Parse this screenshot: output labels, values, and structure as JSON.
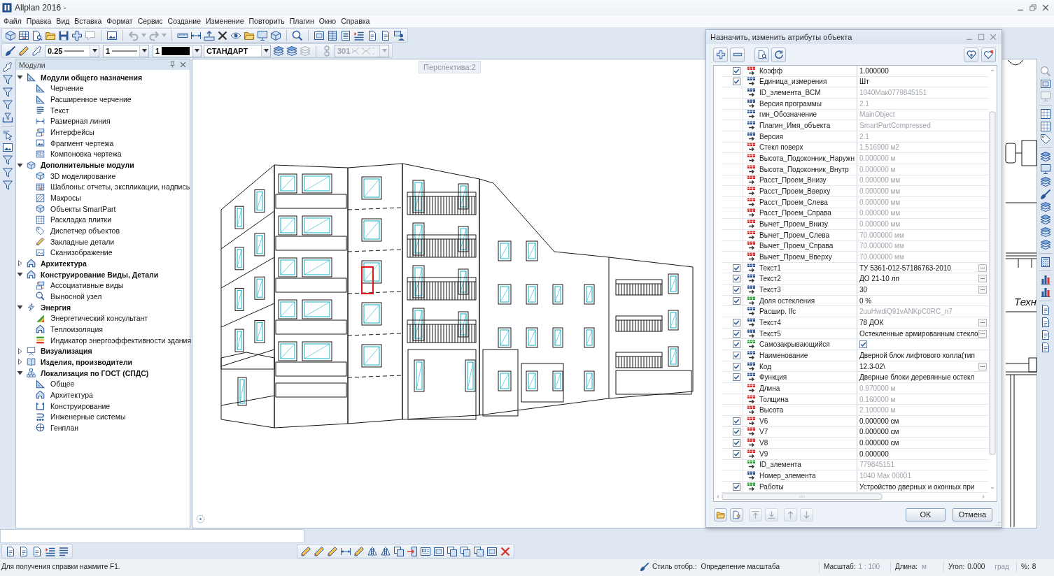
{
  "window": {
    "title": "Allplan 2016 -"
  },
  "menu": [
    "Файл",
    "Правка",
    "Вид",
    "Вставка",
    "Формат",
    "Сервис",
    "Создание",
    "Изменение",
    "Повторить",
    "Плагин",
    "Окно",
    "Справка"
  ],
  "standard_toolbar": [
    {
      "disabled": false
    },
    {
      "disabled": false
    },
    {
      "disabled": false
    },
    {
      "disabled": false
    },
    {
      "disabled": false
    },
    {
      "disabled": false
    },
    {
      "disabled": true
    },
    {
      "disabled": false
    },
    {
      "disabled": true
    },
    {
      "disabled": true
    },
    {
      "disabled": false
    },
    {
      "disabled": false
    },
    {
      "disabled": false
    },
    {
      "disabled": false
    },
    {
      "disabled": false
    },
    {
      "disabled": false
    },
    {
      "disabled": false
    },
    {
      "disabled": false
    },
    {
      "disabled": false
    },
    {
      "disabled": false
    },
    {
      "disabled": false
    },
    {
      "disabled": false
    },
    {
      "disabled": false
    },
    {
      "disabled": false
    },
    {
      "disabled": false
    },
    {
      "disabled": false
    }
  ],
  "format_toolbar": {
    "pen_thickness": "0.25",
    "line_type": "1",
    "color_number": "1",
    "line_style": "СТАНДАРТ",
    "layer_tools": [
      {
        "disabled": false
      },
      {
        "disabled": false
      },
      {
        "disabled": true
      },
      {
        "disabled": true
      }
    ],
    "pattern": {
      "value": "301",
      "disabled": true
    }
  },
  "modules_panel": {
    "title": "Модули",
    "tree": [
      {
        "label": "Модули общего назначения",
        "expanded": true,
        "children": [
          {
            "label": "Черчение"
          },
          {
            "label": "Расширенное черчение"
          },
          {
            "label": "Текст"
          },
          {
            "label": "Размерная линия"
          },
          {
            "label": "Интерфейсы"
          },
          {
            "label": "Фрагмент чертежа"
          },
          {
            "label": "Компоновка чертежа"
          }
        ]
      },
      {
        "label": "Дополнительные модули",
        "expanded": true,
        "children": [
          {
            "label": "3D моделирование"
          },
          {
            "label": "Шаблоны: отчеты, экспликации, надпись"
          },
          {
            "label": "Макросы"
          },
          {
            "label": "Объекты SmartPart"
          },
          {
            "label": "Раскладка плитки"
          },
          {
            "label": "Диспетчер объектов"
          },
          {
            "label": "Закладные детали"
          },
          {
            "label": "Сканизображение"
          }
        ]
      },
      {
        "label": "Архитектура",
        "expanded": false
      },
      {
        "label": "Конструирование Виды, Детали",
        "expanded": true,
        "children": [
          {
            "label": "Ассоциативные виды"
          },
          {
            "label": "Выносной узел"
          }
        ]
      },
      {
        "label": "Энергия",
        "expanded": true,
        "children": [
          {
            "label": "Энергетический консультант"
          },
          {
            "label": "Теплоизоляция"
          },
          {
            "label": "Индикатор энергоэффективности здания"
          }
        ]
      },
      {
        "label": "Визуализация",
        "expanded": false
      },
      {
        "label": "Изделия, производители",
        "expanded": false
      },
      {
        "label": "Локализация по ГОСТ (СПДС)",
        "expanded": true,
        "children": [
          {
            "label": "Общее"
          },
          {
            "label": "Архитектура"
          },
          {
            "label": "Конструирование"
          },
          {
            "label": "Инженерные системы"
          },
          {
            "label": "Генплан"
          }
        ]
      }
    ]
  },
  "viewport": {
    "view_label": "Перспектива:2",
    "drawing_text": "Техн"
  },
  "right_toolbar": [
    {
      "disabled": true
    },
    {
      "disabled": false
    },
    {
      "disabled": true
    },
    {
      "disabled": false
    },
    {
      "disabled": false
    },
    {
      "disabled": false
    },
    {
      "disabled": false
    },
    {
      "disabled": false
    },
    {
      "disabled": false
    },
    {
      "disabled": false
    },
    {
      "disabled": false
    },
    {
      "disabled": false
    },
    {
      "disabled": false
    },
    {
      "disabled": false
    },
    {
      "disabled": false
    },
    {
      "disabled": false
    },
    {
      "disabled": false
    },
    {
      "disabled": false
    },
    {
      "disabled": false
    },
    {
      "disabled": false
    },
    {
      "disabled": false
    }
  ],
  "dialog": {
    "title": "Назначить, изменить атрибуты объекта",
    "rows": [
      {
        "checked": true,
        "kind": "float",
        "name": "Коэфф",
        "value": "1.000000",
        "read_only": false
      },
      {
        "checked": true,
        "kind": "text",
        "name": "Единица_измерения",
        "value": "Шт",
        "read_only": false
      },
      {
        "checked": false,
        "kind": "text",
        "name": "ID_элемента_BCM",
        "value": "1040Мак0779845151",
        "read_only": true
      },
      {
        "checked": false,
        "kind": "text",
        "name": "Версия программы",
        "value": "2.1",
        "read_only": true
      },
      {
        "checked": false,
        "kind": "text",
        "name": "гин_Обозначение",
        "value": "MainObject",
        "read_only": true
      },
      {
        "checked": false,
        "kind": "text",
        "name": "Плагин_Имя_объекта",
        "value": "SmartPartCompressed",
        "read_only": true
      },
      {
        "checked": false,
        "kind": "text",
        "name": "Версия",
        "value": "2.1",
        "read_only": true
      },
      {
        "checked": false,
        "kind": "float",
        "name": "Стекл поверх",
        "value": "1.516900 м2",
        "read_only": true
      },
      {
        "checked": false,
        "kind": "float",
        "name": "Высота_Подоконник_Наружн",
        "value": "0.000000 м",
        "read_only": true
      },
      {
        "checked": false,
        "kind": "float",
        "name": "Высота_Подоконник_Внутр",
        "value": "0.000000 м",
        "read_only": true
      },
      {
        "checked": false,
        "kind": "float",
        "name": "Расст_Проем_Внизу",
        "value": "0.000000 мм",
        "read_only": true
      },
      {
        "checked": false,
        "kind": "float",
        "name": "Расст_Проем_Вверху",
        "value": "0.000000 мм",
        "read_only": true
      },
      {
        "checked": false,
        "kind": "float",
        "name": "Расст_Проем_Слева",
        "value": "0.000000 мм",
        "read_only": true
      },
      {
        "checked": false,
        "kind": "float",
        "name": "Расст_Проем_Справа",
        "value": "0.000000 мм",
        "read_only": true
      },
      {
        "checked": false,
        "kind": "float",
        "name": "Вычет_Проем_Внизу",
        "value": "0.000000 мм",
        "read_only": true
      },
      {
        "checked": false,
        "kind": "float",
        "name": "Вычет_Проем_Слева",
        "value": "70.000000 мм",
        "read_only": true
      },
      {
        "checked": false,
        "kind": "float",
        "name": "Вычет_Проем_Справа",
        "value": "70.000000 мм",
        "read_only": true
      },
      {
        "checked": false,
        "kind": "float",
        "name": "Вычет_Проем_Вверху",
        "value": "70.000000 мм",
        "read_only": true
      },
      {
        "checked": true,
        "kind": "text",
        "name": "Текст1",
        "value": "ТУ 5361-012-57186763-2010",
        "read_only": false,
        "button": "..."
      },
      {
        "checked": true,
        "kind": "text",
        "name": "Текст2",
        "value": "ДО 21-10 лп",
        "read_only": false,
        "button": "..."
      },
      {
        "checked": true,
        "kind": "text",
        "name": "Текст3",
        "value": "30",
        "read_only": false,
        "button": "..."
      },
      {
        "checked": true,
        "kind": "integer",
        "name": "Доля остекления",
        "value": "0 %",
        "read_only": false
      },
      {
        "checked": false,
        "kind": "text",
        "name": "Расшир. Ifc",
        "value": "2uuHwdiQ91vANKpC0RC_n7",
        "read_only": true
      },
      {
        "checked": true,
        "kind": "text",
        "name": "Текст4",
        "value": "78 ДОК",
        "read_only": false,
        "button": "..."
      },
      {
        "checked": true,
        "kind": "text",
        "name": "Текст5",
        "value": "Остекленные армированным стекло",
        "read_only": false,
        "button": "..."
      },
      {
        "checked": true,
        "kind": "integer",
        "name": "Самозакрывающийся",
        "value_checked": true,
        "read_only": false
      },
      {
        "checked": true,
        "kind": "text",
        "name": "Наименование",
        "value": "Дверной блок лифтового холла(тип",
        "read_only": false
      },
      {
        "checked": true,
        "kind": "text",
        "name": "Код",
        "value": "12.3-02\\",
        "read_only": false,
        "button": "..."
      },
      {
        "checked": true,
        "kind": "text",
        "name": "Функция",
        "value": "Дверные блоки деревянные остекл",
        "read_only": false
      },
      {
        "checked": false,
        "kind": "float",
        "name": "Длина",
        "value": "0.970000 м",
        "read_only": true
      },
      {
        "checked": false,
        "kind": "float",
        "name": "Толщина",
        "value": "0.160000 м",
        "read_only": true
      },
      {
        "checked": false,
        "kind": "float",
        "name": "Высота",
        "value": "2.100000 м",
        "read_only": true
      },
      {
        "checked": true,
        "kind": "float",
        "name": "V6",
        "value": "0.000000 см",
        "read_only": false
      },
      {
        "checked": true,
        "kind": "float",
        "name": "V7",
        "value": "0.000000 см",
        "read_only": false
      },
      {
        "checked": true,
        "kind": "float",
        "name": "V8",
        "value": "0.000000 см",
        "read_only": false
      },
      {
        "checked": true,
        "kind": "float",
        "name": "V9",
        "value": "0.000000",
        "read_only": false
      },
      {
        "checked": false,
        "kind": "integer",
        "name": "ID_элемента",
        "value": "779845151",
        "read_only": true
      },
      {
        "checked": false,
        "kind": "text",
        "name": "Номер_элемента",
        "value": "1040 Мак 00001",
        "read_only": true
      },
      {
        "checked": true,
        "kind": "integer",
        "name": "Работы",
        "value": "Устройство дверных и оконных при",
        "read_only": false
      }
    ],
    "tools": [
      {
        "disabled": false
      },
      {
        "disabled": false
      },
      {
        "disabled": true
      },
      {
        "disabled": true
      },
      {
        "disabled": true
      },
      {
        "disabled": true
      }
    ],
    "buttons": [
      "OK",
      "Отмена"
    ]
  },
  "status_bar": {
    "help": "Для получения справки нажмите F1.",
    "display_style": {
      "label": "Стиль отобр.:",
      "value": "Определение масштаба"
    },
    "scale": {
      "label": "Масштаб:",
      "value": "1 : 100"
    },
    "length": {
      "label": "Длина:",
      "unit": "м"
    },
    "angle": {
      "label": "Угол:",
      "value": "0.000",
      "unit": "град"
    },
    "percent": {
      "label": "%:",
      "value": "8"
    }
  }
}
